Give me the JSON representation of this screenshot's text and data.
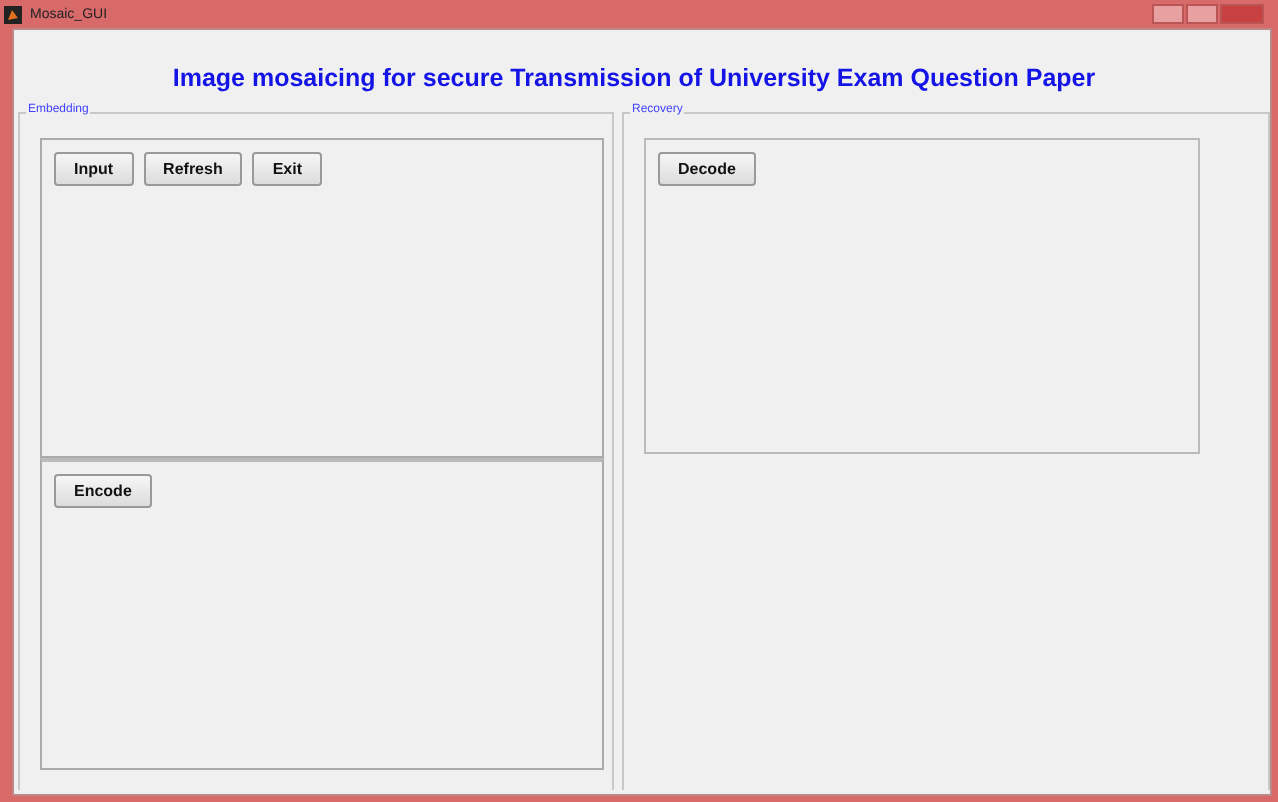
{
  "window": {
    "title": "Mosaic_GUI"
  },
  "heading": "Image mosaicing for secure Transmission of University Exam Question Paper",
  "embedding": {
    "label": "Embedding",
    "top_buttons": [
      "Input",
      "Refresh",
      "Exit"
    ],
    "bottom_buttons": [
      "Encode"
    ]
  },
  "recovery": {
    "label": "Recovery",
    "buttons": [
      "Decode"
    ]
  }
}
